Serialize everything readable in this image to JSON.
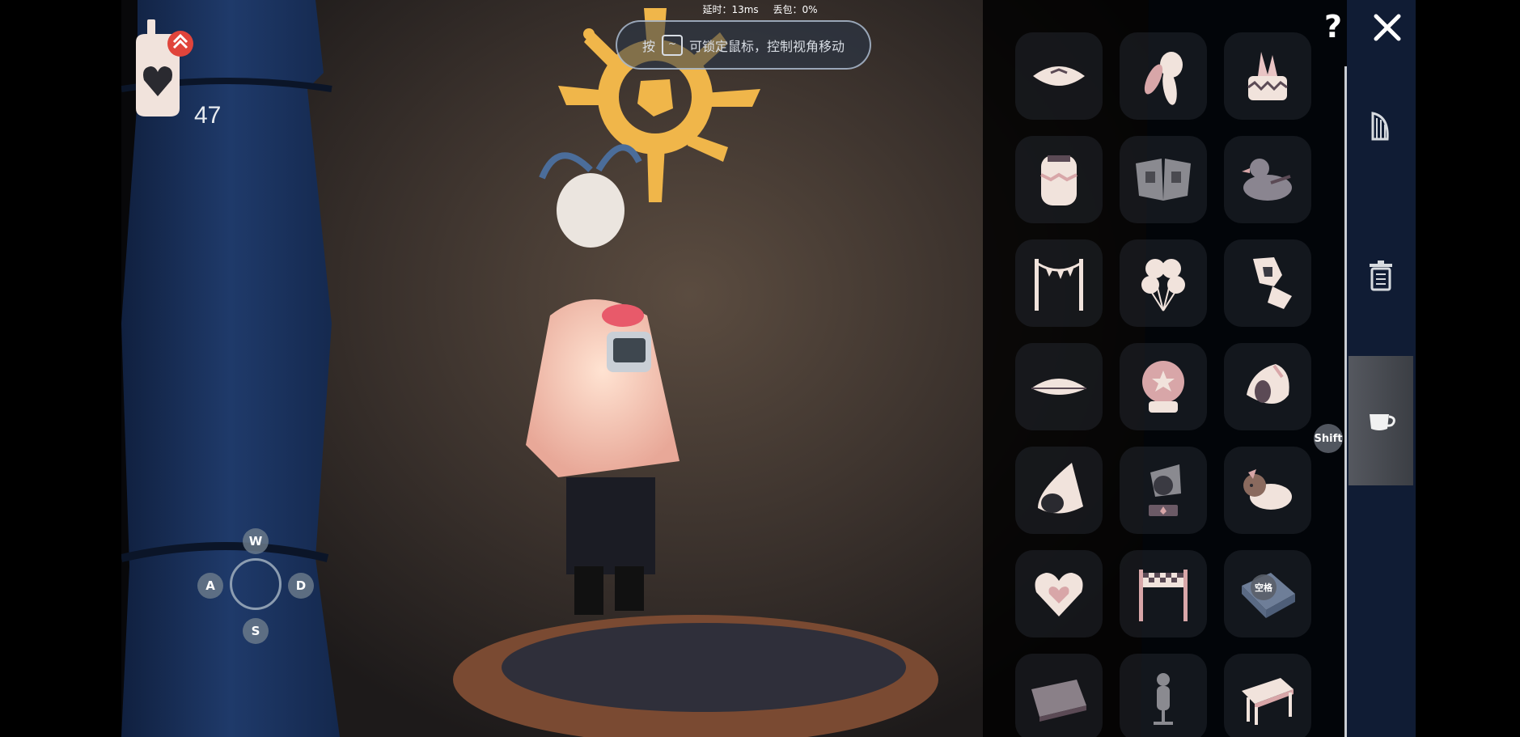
{
  "hud": {
    "latency": "延时：13ms",
    "packet_loss": "丢包：0%",
    "lock_hint_prefix": "按",
    "lock_hint_key": "~",
    "lock_hint_text": "可锁定鼠标，控制视角移动",
    "heart_count": "47"
  },
  "movement": {
    "up": "W",
    "left": "A",
    "right": "D",
    "down": "S"
  },
  "panel": {
    "help": "?",
    "shift_key": "Shift",
    "space_key": "空格",
    "items": [
      "pillow-icon",
      "feather-icon",
      "crystal-cake-icon",
      "jar-icon",
      "wing-stone-icon",
      "bird-icon",
      "bunting-icon",
      "balloons-icon",
      "rock-icon",
      "cushion-icon",
      "snowglobe-icon",
      "conch-icon",
      "shell-icon",
      "telescope-icon",
      "deer-plush-icon",
      "heart-icon",
      "finish-gate-icon",
      "blanket-icon",
      "mat-icon",
      "mannequin-icon",
      "table-icon"
    ],
    "tabs": [
      "harp-icon",
      "trash-icon",
      "cup-icon"
    ],
    "active_tab": "cup-icon"
  },
  "colors": {
    "accent": "#e8c36a",
    "item_fill": "#f1e3dc",
    "item_dark": "#5b4a55",
    "badge_red": "#e0443b"
  }
}
